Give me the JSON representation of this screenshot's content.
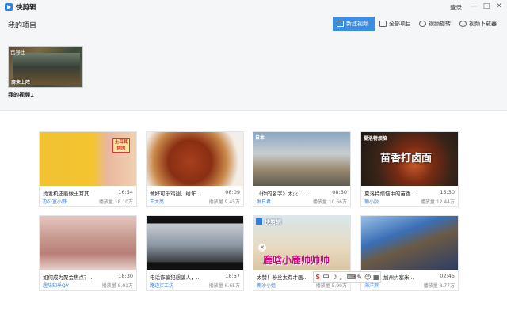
{
  "app": {
    "title": "快剪辑",
    "login": "登录"
  },
  "window": {
    "minimize": "—",
    "maximize": "□",
    "close": "✕"
  },
  "toolbar": {
    "page_title": "我的项目",
    "new_video": "新建视频",
    "all_projects": "全部项目",
    "rotate_video": "视频旋转",
    "video_downloader": "视频下载器"
  },
  "projects": [
    {
      "tag": "已导出",
      "caption": "裔来上阵",
      "name": "我的视频1"
    }
  ],
  "videos": [
    {
      "title": "烫发机还能做土耳其...",
      "duration": "16:54",
      "author": "办公室小野",
      "plays_label": "播放量",
      "plays": "18.10万",
      "overlay": "土耳其烤肉"
    },
    {
      "title": "做好可乐鸡翅，给年...",
      "duration": "08:09",
      "author": "王大亮",
      "plays_label": "播放量",
      "plays": "9.45万"
    },
    {
      "title": "《你的名字》太火！...",
      "duration": "08:30",
      "author": "发日君",
      "plays_label": "播放量",
      "plays": "10.66万",
      "overlay": "日本"
    },
    {
      "title": "夏洛特烦恼中的苗香...",
      "duration": "15:30",
      "author": "葡小厨",
      "plays_label": "播放量",
      "plays": "12.44万",
      "overlay": "苗香打卤面",
      "overlay_tag": "夏洛特烦恼"
    },
    {
      "title": "如何成为聚会焦点？...",
      "duration": "18:30",
      "author": "趣味知乎QV",
      "plays_label": "播放量",
      "plays": "8.01万"
    },
    {
      "title": "电话诈骗犯想骗人，...",
      "duration": "18:57",
      "author": "路边买工坊",
      "plays_label": "播放量",
      "plays": "6.65万"
    },
    {
      "title": "太赞！粉丝太有才画...",
      "duration": "",
      "author": "鹿沙小姐",
      "plays_label": "播放量",
      "plays": "5.99万",
      "overlay": "鹿晗小鹿帅帅帅",
      "overlay_tag": "快剪辑"
    },
    {
      "title": "加州约塞米...",
      "duration": "02:45",
      "author": "海洋滨",
      "plays_label": "播放量",
      "plays": "8.77万"
    }
  ],
  "ime": {
    "s_icon": "S",
    "lang": "中",
    "moon": "☽",
    "punct": "。",
    "keyboard": "⌨",
    "tools": "✎",
    "user": "☺",
    "grid": "▦"
  }
}
